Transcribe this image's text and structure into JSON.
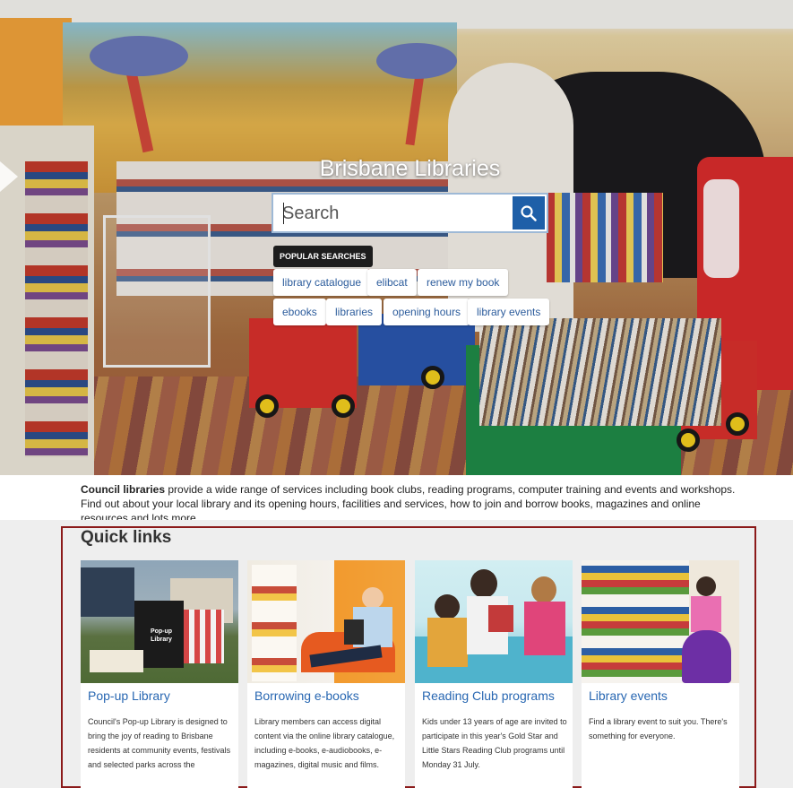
{
  "hero": {
    "title": "Brisbane Libraries",
    "search_placeholder": "Search",
    "search_button_icon": "search-icon",
    "popular_label": "POPULAR SEARCHES",
    "popular_searches": [
      "library catalogue",
      "elibcat",
      "renew my book",
      "ebooks",
      "libraries",
      "opening hours",
      "library events"
    ]
  },
  "intro": {
    "bold": "Council libraries",
    "text": " provide a wide range of services including book clubs, reading programs, computer training and events and workshops. Find out about your local library and its opening hours, facilities and services, how to join and borrow books, magazines and online resources and lots more."
  },
  "quick_links": {
    "title": "Quick links",
    "cards": [
      {
        "title": "Pop-up Library",
        "description": "Council's Pop-up Library is designed to bring the joy of reading to Brisbane residents at community events, festivals and selected parks across the",
        "image_sign": "Pop-up Library"
      },
      {
        "title": "Borrowing e-books",
        "description": "Library members can access digital content via the online library catalogue, including e-books, e-audiobooks, e-magazines, digital music and films."
      },
      {
        "title": "Reading Club programs",
        "description": "Kids under 13 years of age are invited to participate in this year's Gold Star and Little Stars Reading Club programs until Monday 31 July."
      },
      {
        "title": "Library events",
        "description": "Find a library event to suit you. There's something for everyone."
      }
    ]
  },
  "colors": {
    "link_blue": "#2867b2",
    "search_button": "#1e5fa8",
    "highlight_border": "#8b1a1a"
  }
}
